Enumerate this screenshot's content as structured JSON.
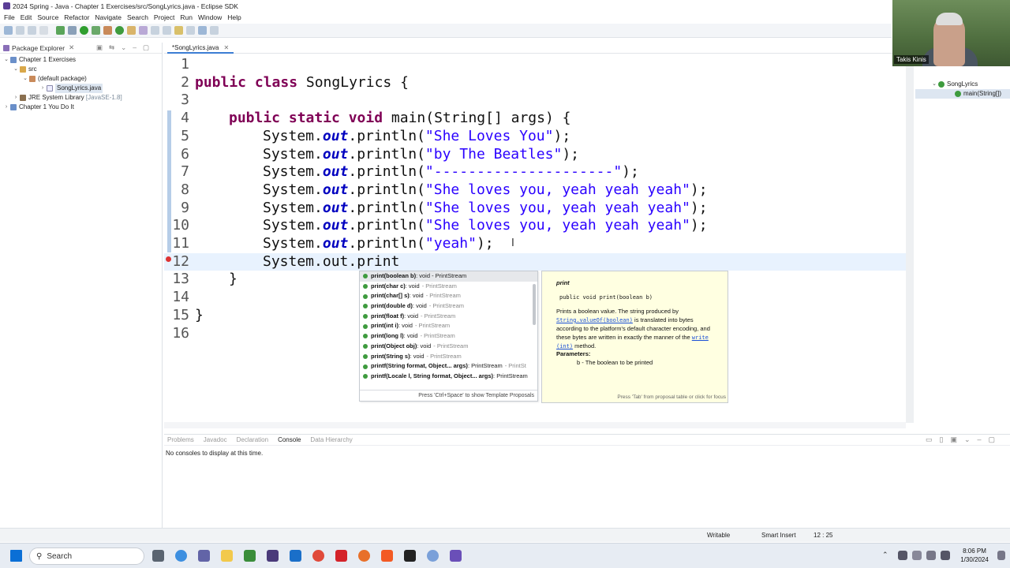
{
  "window": {
    "title": "2024 Spring - Java - Chapter 1 Exercises/src/SongLyrics.java - Eclipse SDK"
  },
  "menu": [
    "File",
    "Edit",
    "Source",
    "Refactor",
    "Navigate",
    "Search",
    "Project",
    "Run",
    "Window",
    "Help"
  ],
  "package_explorer": {
    "title": "Package Explorer",
    "items": [
      {
        "label": "Chapter 1 Exercises",
        "suffix": ""
      },
      {
        "label": "src",
        "suffix": ""
      },
      {
        "label": "(default package)",
        "suffix": ""
      },
      {
        "label": "SongLyrics.java",
        "suffix": ""
      },
      {
        "label": "JRE System Library",
        "suffix": "[JavaSE-1.8]"
      },
      {
        "label": "Chapter 1 You Do It",
        "suffix": ""
      }
    ]
  },
  "editor": {
    "tab_label": "*SongLyrics.java",
    "lines": [
      {
        "n": "1"
      },
      {
        "n": "2"
      },
      {
        "n": "3"
      },
      {
        "n": "4"
      },
      {
        "n": "5"
      },
      {
        "n": "6"
      },
      {
        "n": "7"
      },
      {
        "n": "8"
      },
      {
        "n": "9"
      },
      {
        "n": "10"
      },
      {
        "n": "11"
      },
      {
        "n": "12"
      },
      {
        "n": "13"
      },
      {
        "n": "14"
      },
      {
        "n": "15"
      },
      {
        "n": "16"
      }
    ],
    "code": {
      "l2_kw": "public class",
      "l2_rest": " SongLyrics {",
      "l4_kw": "public static void",
      "l4_rest": " main(String[] args) {",
      "sys": "System.",
      "out": "out",
      "println": ".println(",
      "close": ");",
      "s5": "\"She Loves You\"",
      "s6": "\"by The Beatles\"",
      "s7": "\"---------------------\"",
      "s8": "\"She loves you, yeah yeah yeah\"",
      "s9": "\"She loves you, yeah yeah yeah\"",
      "s10": "\"She loves you, yeah yeah yeah\"",
      "s11": "\"yeah\"",
      "l12": "System.out.print",
      "l13": "}",
      "l15": "}"
    }
  },
  "content_assist": {
    "proposals": [
      {
        "name": "print(boolean b)",
        "ret": " : void - PrintStream",
        "cls": ""
      },
      {
        "name": "print(char c)",
        "ret": " : void",
        "cls": "- PrintStream"
      },
      {
        "name": "print(char[] s)",
        "ret": " : void",
        "cls": "- PrintStream"
      },
      {
        "name": "print(double d)",
        "ret": " : void",
        "cls": "- PrintStream"
      },
      {
        "name": "print(float f)",
        "ret": " : void",
        "cls": "- PrintStream"
      },
      {
        "name": "print(int i)",
        "ret": " : void",
        "cls": "- PrintStream"
      },
      {
        "name": "print(long l)",
        "ret": " : void",
        "cls": "- PrintStream"
      },
      {
        "name": "print(Object obj)",
        "ret": " : void",
        "cls": "- PrintStream"
      },
      {
        "name": "print(String s)",
        "ret": " : void",
        "cls": "- PrintStream"
      },
      {
        "name": "printf(String format, Object... args)",
        "ret": " : PrintStream",
        "cls": "- PrintSt"
      },
      {
        "name": "printf(Locale l, String format, Object... args)",
        "ret": " : PrintStream",
        "cls": ""
      }
    ],
    "footer": "Press 'Ctrl+Space' to show Template Proposals"
  },
  "javadoc": {
    "title": "print",
    "signature": "public void print(boolean b)",
    "text1": "Prints a boolean value. The string produced by",
    "link1": "String.valueOf(boolean)",
    "text2": " is translated into bytes according to the platform's default character encoding, and these bytes are written in exactly the manner of the ",
    "link2": "write (int)",
    "text3": " method.",
    "params_label": "Parameters:",
    "param": "b - The boolean to be printed",
    "footer": "Press 'Tab' from proposal table or click for focus"
  },
  "outline": {
    "class": "SongLyrics",
    "method": "main(String[])"
  },
  "video": {
    "name": "Takis Kinis"
  },
  "bottom_panel": {
    "tabs": [
      "Problems",
      "Javadoc",
      "Declaration",
      "Console",
      "Data Hierarchy"
    ],
    "message": "No consoles to display at this time."
  },
  "status": {
    "writable": "Writable",
    "insert_mode": "Smart Insert",
    "position": "12 : 25"
  },
  "taskbar": {
    "search_placeholder": "Search",
    "time": "8:06 PM",
    "date": "1/30/2024"
  }
}
